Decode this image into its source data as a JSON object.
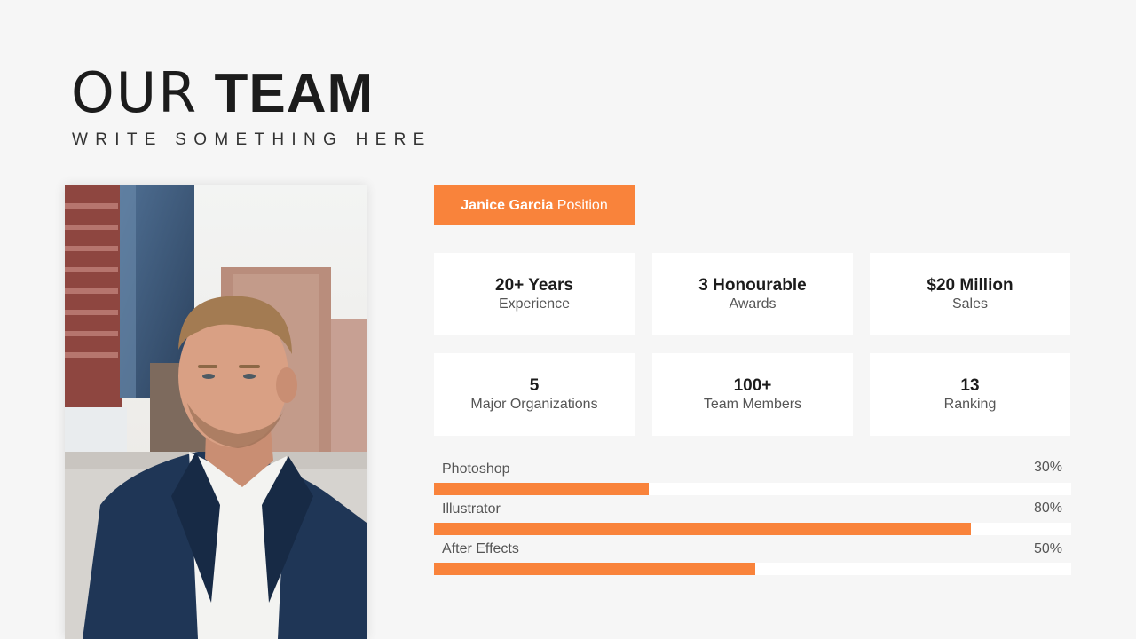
{
  "header": {
    "title_light": "OUR",
    "title_bold": "TEAM",
    "subtitle": "WRITE SOMETHING HERE"
  },
  "profile": {
    "name": "Janice Garcia",
    "position": "Position"
  },
  "stats": [
    {
      "value": "20+ Years",
      "label": "Experience"
    },
    {
      "value": "3 Honourable",
      "label": "Awards"
    },
    {
      "value": "$20 Million",
      "label": "Sales"
    },
    {
      "value": "5",
      "label": "Major Organizations"
    },
    {
      "value": "100+",
      "label": "Team Members"
    },
    {
      "value": "13",
      "label": "Ranking"
    }
  ],
  "skills": [
    {
      "name": "Photoshop",
      "percent_label": "30%",
      "level": 0.337
    },
    {
      "name": "Illustrator",
      "percent_label": "80%",
      "level": 0.843
    },
    {
      "name": "After Effects",
      "percent_label": "50%",
      "level": 0.504
    }
  ],
  "colors": {
    "accent": "#f9833b",
    "background": "#f6f6f6",
    "card": "#ffffff"
  }
}
